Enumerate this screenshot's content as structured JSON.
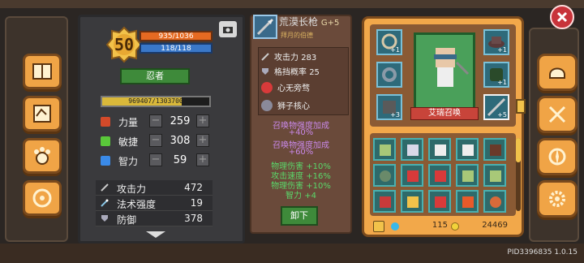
{
  "player": {
    "level": "50",
    "hp": "935/1036",
    "mp": "118/118",
    "class": "忍者",
    "xp_text": "969407/1303700",
    "xp_fraction": 0.744
  },
  "attributes": [
    {
      "label": "力量",
      "value": "259",
      "color": "#d44a2a"
    },
    {
      "label": "敏捷",
      "value": "308",
      "color": "#5ac83a"
    },
    {
      "label": "智力",
      "value": "59",
      "color": "#3a8ae8"
    }
  ],
  "stats": [
    {
      "label": "攻击力",
      "value": "472"
    },
    {
      "label": "法术强度",
      "value": "19"
    },
    {
      "label": "防御",
      "value": "378"
    }
  ],
  "item": {
    "name": "荒漠长枪",
    "grade": "G+5",
    "owner": "拜月的伯德",
    "attack_label": "攻击力",
    "attack_value": "283",
    "block_label": "格挡概率",
    "block_value": "25",
    "skills": [
      "心无旁骛",
      "狮子核心"
    ],
    "bonuses": [
      {
        "text": "召唤物强度加成",
        "color": "#c888e8"
      },
      {
        "text": "+40%",
        "color": "#c888e8"
      },
      {
        "text": "召唤物强度加成",
        "color": "#c888e8"
      },
      {
        "text": "+60%",
        "color": "#c888e8"
      },
      {
        "text": "物理伤害 +10%",
        "color": "#5ad86a"
      },
      {
        "text": "攻击速度 +16%",
        "color": "#5ad86a"
      },
      {
        "text": "物理伤害 +10%",
        "color": "#5ad86a"
      },
      {
        "text": "智力 +4",
        "color": "#5ad86a"
      }
    ],
    "unequip_label": "卸下"
  },
  "equipment": {
    "character_name": "艾瑞召唤",
    "slots": [
      {
        "name": "necklace",
        "badge": "+1"
      },
      {
        "name": "hat",
        "badge": "+1"
      },
      {
        "name": "ring",
        "badge": ""
      },
      {
        "name": "armor",
        "badge": "+1"
      },
      {
        "name": "gauntlet",
        "badge": "+3"
      },
      {
        "name": "spear",
        "badge": "+5"
      }
    ]
  },
  "currency": {
    "gems": "115",
    "gold": "24469"
  },
  "build_id": "PID3396835 1.0.15"
}
